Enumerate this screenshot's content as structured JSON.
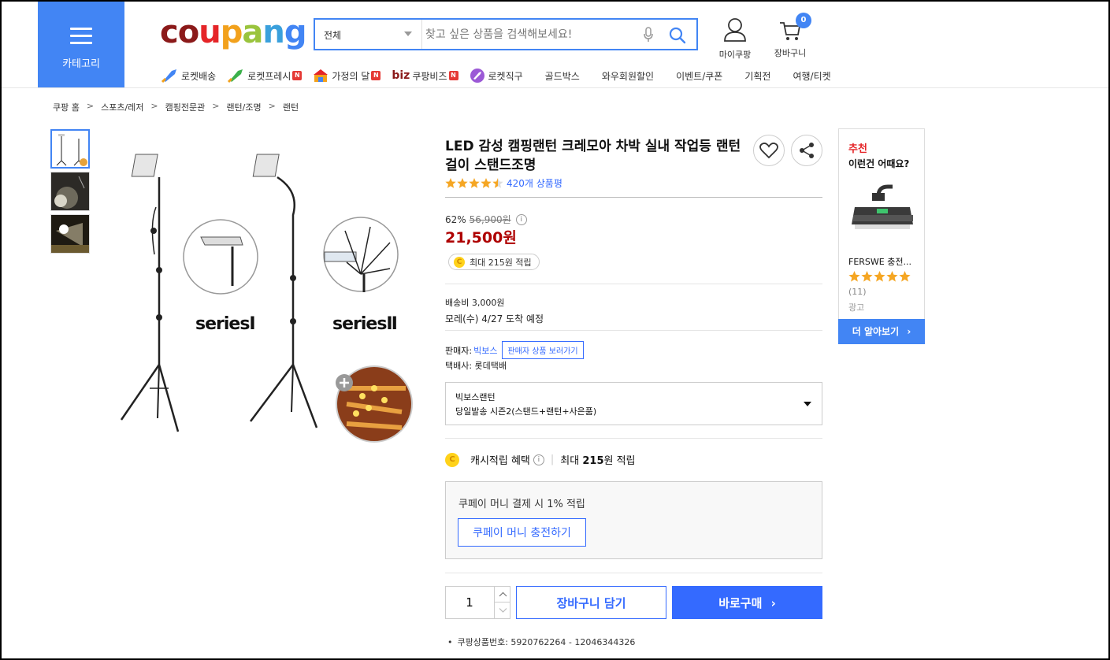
{
  "header": {
    "category_label": "카테고리",
    "logo": "coupang",
    "search": {
      "category": "전체",
      "placeholder": "찾고 싶은 상품을 검색해보세요!"
    },
    "my_coupang": "마이쿠팡",
    "cart_label": "장바구니",
    "cart_count": "0"
  },
  "nav": {
    "items": [
      {
        "label": "로켓배송",
        "icon": "rocket-icon"
      },
      {
        "label": "로켓프레시",
        "icon": "rocket-fresh-icon",
        "badge": "N"
      },
      {
        "label": "가정의 달",
        "icon": "family-month-icon",
        "badge": "N"
      },
      {
        "label": "쿠팡비즈",
        "prefix": "biz",
        "badge": "N"
      },
      {
        "label": "로켓직구",
        "icon": "rocket-global-icon"
      },
      {
        "label": "골드박스"
      },
      {
        "label": "와우회원할인"
      },
      {
        "label": "이벤트/쿠폰"
      },
      {
        "label": "기획전"
      },
      {
        "label": "여행/티켓"
      }
    ]
  },
  "breadcrumb": [
    "쿠팡 홈",
    "스포츠/레저",
    "캠핑전문관",
    "랜턴/조명",
    "랜턴"
  ],
  "gallery": {
    "series_1": "seriesⅠ",
    "series_2": "seriesⅡ"
  },
  "product": {
    "title": "LED 감성 캠핑랜턴 크레모아 차박 실내 작업등 랜턴걸이 스탠드조명",
    "rating": 4.5,
    "review_count": "420개 상품평",
    "discount_rate": "62%",
    "original_price": "56,900원",
    "price": "21,500원",
    "reward": "최대 215원 적립",
    "shipping_fee": "배송비 3,000원",
    "arrival": "모레(수) 4/27 도착 예정",
    "seller_label": "판매자:",
    "seller_name": "빅보스",
    "seller_link": "판매자 상품 보러가기",
    "courier": "택배사: 롯데택배",
    "option_title": "빅보스랜턴",
    "option_value": "당일발송 시즌2(스탠드+랜턴+사은품)",
    "cash_label": "캐시적립 혜택",
    "cash_value_prefix": "최대 ",
    "cash_value_amount": "215",
    "cash_value_suffix": "원 적립",
    "coupay_text": "쿠페이 머니 결제 시 1% 적립",
    "coupay_button": "쿠페이 머니 충전하기",
    "quantity": "1",
    "add_to_cart": "장바구니 담기",
    "buy_now": "바로구매",
    "product_id": "쿠팡상품번호: 5920762264 - 12046344326"
  },
  "recommend": {
    "title": "추천",
    "subtitle": "이런건 어때요?",
    "product_name": "FERSWE 충전...",
    "rating": 5,
    "count": "(11)",
    "ad": "광고",
    "more": "더 알아보기"
  },
  "colors": {
    "brand_blue": "#346aff",
    "category_blue": "#4285f4",
    "price_red": "#ae0000",
    "star": "#f5a623"
  }
}
